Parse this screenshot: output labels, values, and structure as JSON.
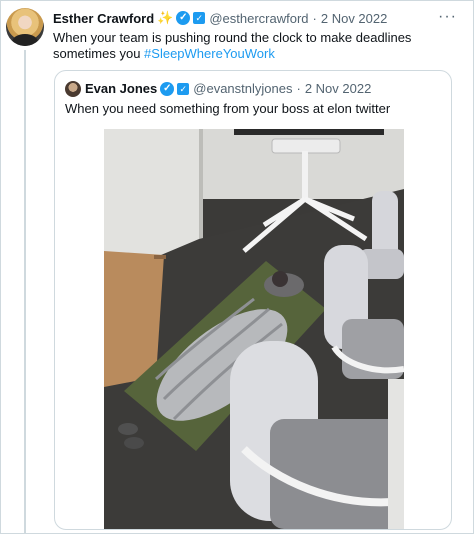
{
  "tweet": {
    "author_name": "Esther Crawford",
    "author_emoji": "✨",
    "handle": "@esthercrawford",
    "date": "2 Nov 2022",
    "more_icon": "more-options-icon",
    "text": "When your team is pushing round the clock to make deadlines sometimes you ",
    "hashtag": "#SleepWhereYouWork"
  },
  "quoted_tweet": {
    "author_name": "Evan Jones",
    "handle": "@evanstnlyjones",
    "date": "2 Nov 2022",
    "text": "When you need something from your boss at elon twitter"
  },
  "colors": {
    "link": "#1d9bf0",
    "secondary_text": "#536471",
    "border": "#cfd9de"
  }
}
